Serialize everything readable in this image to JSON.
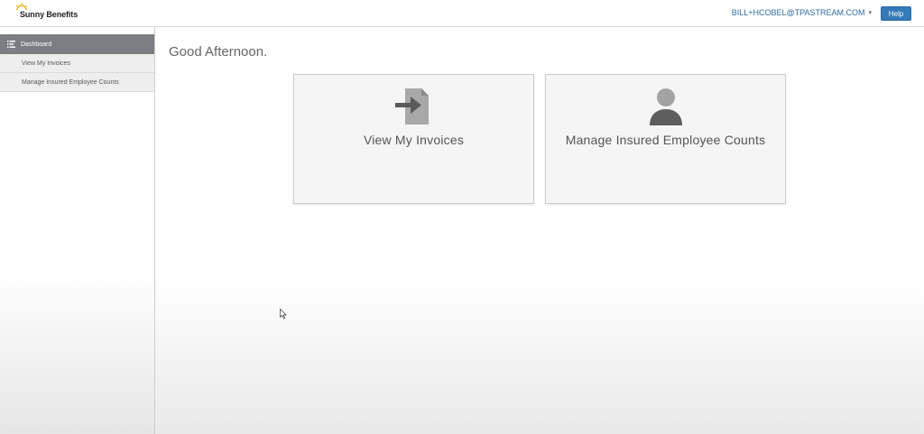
{
  "header": {
    "logo_text": "Sunny Benefits",
    "user_email": "BILL+HCOBEL@TPASTREAM.COM",
    "help_label": "Help"
  },
  "sidebar": {
    "active_label": "Dashboard",
    "items": [
      {
        "label": "View My Invoices"
      },
      {
        "label": "Manage Insured Employee Counts"
      }
    ]
  },
  "main": {
    "greeting": "Good Afternoon.",
    "tiles": [
      {
        "label": "View My Invoices",
        "icon": "invoice-arrow-icon"
      },
      {
        "label": "Manage Insured Employee Counts",
        "icon": "user-icon"
      }
    ]
  },
  "colors": {
    "primary": "#337ab7",
    "sidebar_active": "#7b7e83",
    "logo_sun": "#f0b323"
  }
}
